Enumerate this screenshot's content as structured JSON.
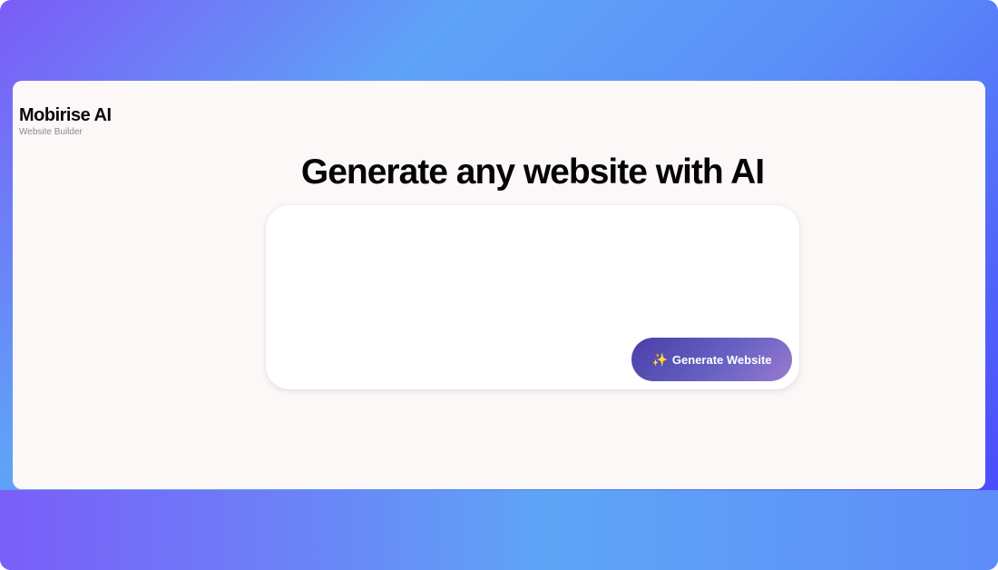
{
  "brand": {
    "name": "Mobirise AI",
    "subtitle": "Website Builder"
  },
  "main": {
    "headline": "Generate any website with AI",
    "prompt": {
      "value": "",
      "placeholder": ""
    },
    "generate_button": {
      "icon": "sparkles-icon",
      "label": "Generate Website"
    }
  },
  "colors": {
    "window_bg": "#fdf8f8",
    "button_gradient_start": "#4b3fa8",
    "button_gradient_end": "#9a7ad0",
    "backdrop_gradient": [
      "#7b5cf7",
      "#5ea3f7",
      "#4a44fd"
    ]
  }
}
